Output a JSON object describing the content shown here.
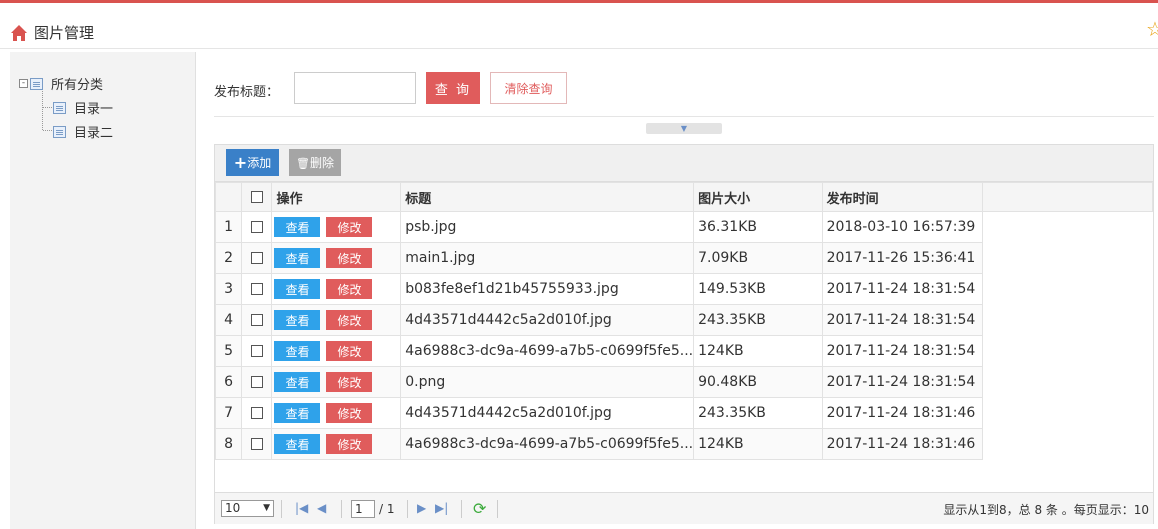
{
  "header": {
    "title": "图片管理",
    "home_icon": "home-icon",
    "favorite_icon": "star-icon"
  },
  "tree": {
    "root": {
      "label": "所有分类",
      "toggle": "-"
    },
    "children": [
      {
        "label": "目录一"
      },
      {
        "label": "目录二"
      }
    ]
  },
  "search": {
    "label": "发布标题：",
    "value": "",
    "query_label": "查 询",
    "clear_label": "清除查询",
    "collapse_arrow": "▼"
  },
  "toolbar": {
    "add_label": "添加",
    "add_glyph": "+",
    "delete_label": "删除",
    "delete_glyph": "🗑"
  },
  "table": {
    "columns": {
      "actions": "操作",
      "title": "标题",
      "size": "图片大小",
      "time": "发布时间"
    },
    "view_label": "查看",
    "edit_label": "修改",
    "rows": [
      {
        "n": "1",
        "title": "psb.jpg",
        "size": "36.31KB",
        "time": "2018-03-10 16:57:39"
      },
      {
        "n": "2",
        "title": "main1.jpg",
        "size": "7.09KB",
        "time": "2017-11-26 15:36:41"
      },
      {
        "n": "3",
        "title": "b083fe8ef1d21b45755933.jpg",
        "size": "149.53KB",
        "time": "2017-11-24 18:31:54"
      },
      {
        "n": "4",
        "title": "4d43571d4442c5a2d010f.jpg",
        "size": "243.35KB",
        "time": "2017-11-24 18:31:54"
      },
      {
        "n": "5",
        "title": "4a6988c3-dc9a-4699-a7b5-c0699f5fe5...",
        "size": "124KB",
        "time": "2017-11-24 18:31:54"
      },
      {
        "n": "6",
        "title": "0.png",
        "size": "90.48KB",
        "time": "2017-11-24 18:31:54"
      },
      {
        "n": "7",
        "title": "4d43571d4442c5a2d010f.jpg",
        "size": "243.35KB",
        "time": "2017-11-24 18:31:46"
      },
      {
        "n": "8",
        "title": "4a6988c3-dc9a-4699-a7b5-c0699f5fe5...",
        "size": "124KB",
        "time": "2017-11-24 18:31:46"
      }
    ]
  },
  "pager": {
    "page_size": "10",
    "page_size_arrow": "▼",
    "current_page": "1",
    "total_pages": "/ 1",
    "first": "|◀",
    "prev": "◀",
    "next": "▶",
    "last": "▶|",
    "refresh": "⟳",
    "info": "显示从1到8，总 8 条 。每页显示：10"
  },
  "colors": {
    "accent_red": "#e05c5c",
    "blue_button": "#3a80c8",
    "view_button": "#2fa2ea"
  }
}
